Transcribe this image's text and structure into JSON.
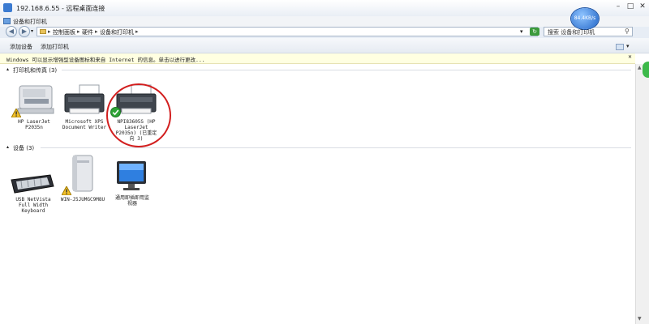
{
  "rdp": {
    "title": "192.168.6.55 - 远程桌面连接",
    "speed": "84.4KB/s"
  },
  "window": {
    "title": "设备和打印机"
  },
  "address": {
    "crumbs": [
      "控制面板",
      "硬件",
      "设备和打印机"
    ],
    "search_placeholder": "搜索 设备和打印机"
  },
  "toolbar": {
    "add_device": "添加设备",
    "add_printer": "添加打印机"
  },
  "info_bar": {
    "text": "Windows 可以显示增强型设备图标和来自 Internet 的信息。单击以进行更改..."
  },
  "groups": {
    "printers": {
      "header": "打印机和传真 (3)",
      "items": [
        {
          "label": "HP LaserJet\nP2035n",
          "warning": true
        },
        {
          "label": "Microsoft XPS\nDocument Writer",
          "warning": false
        },
        {
          "label": "NPI83605S (HP\nLaserJet\nP2035n) (已重定\n向 3)",
          "default": true
        }
      ]
    },
    "devices": {
      "header": "设备 (3)",
      "items": [
        {
          "label": "USB NetVista\nFull Width\nKeyboard"
        },
        {
          "label": "WIN-J5JUMGC9M8U",
          "warning": true
        },
        {
          "label": "通用即插即用监\n视器"
        }
      ]
    }
  },
  "colors": {
    "annotation": "#d21f1f",
    "info_bg": "#ffffe1",
    "accent": "#1f63c6"
  }
}
